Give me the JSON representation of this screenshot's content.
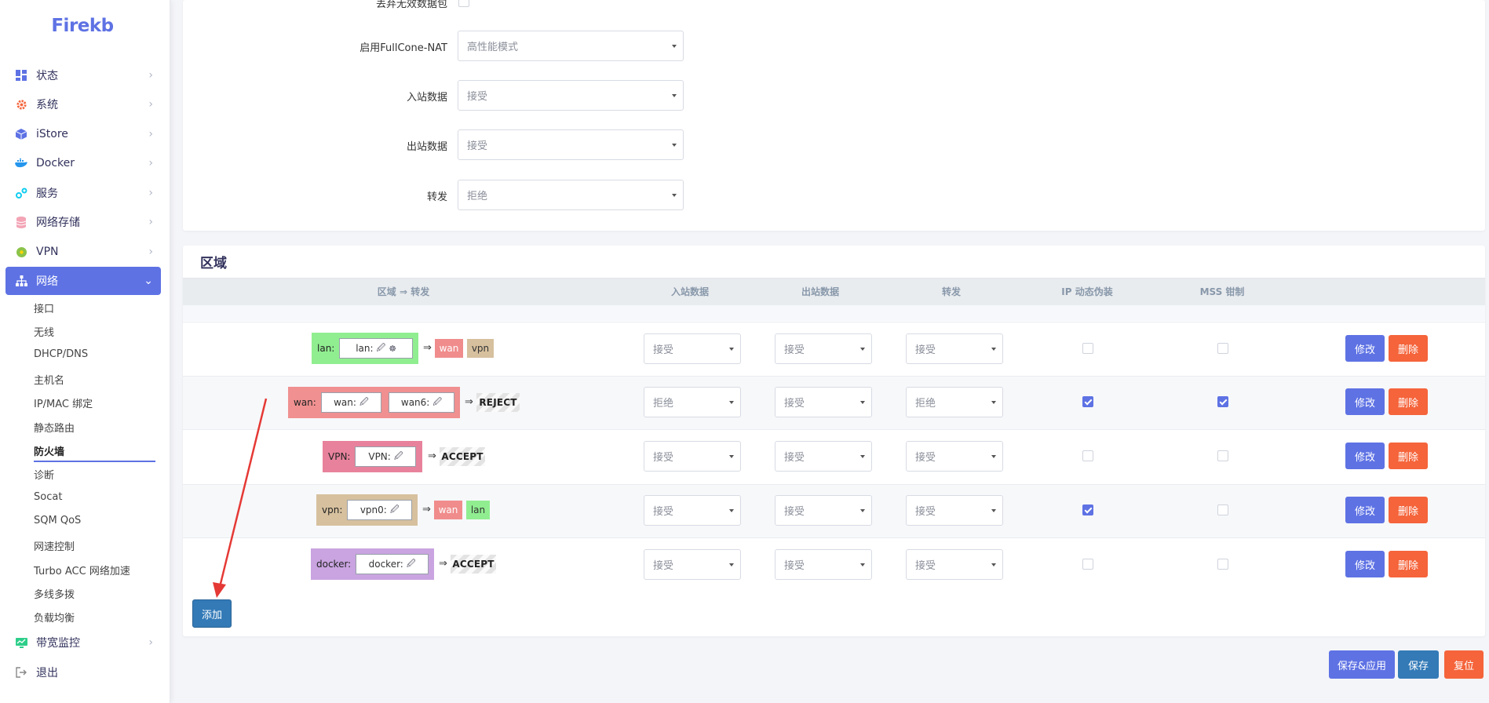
{
  "brand": "Firekb",
  "sidebar": {
    "items": [
      {
        "label": "状态",
        "icon": "dashboard-icon",
        "color": "#5e72e4"
      },
      {
        "label": "系统",
        "icon": "gear-icon",
        "color": "#f5643b"
      },
      {
        "label": "iStore",
        "icon": "cube-icon",
        "color": "#5e72e4"
      },
      {
        "label": "Docker",
        "icon": "docker-icon",
        "color": "#2496ed"
      },
      {
        "label": "服务",
        "icon": "services-icon",
        "color": "#11cdef"
      },
      {
        "label": "网络存储",
        "icon": "database-icon",
        "color": "#f3a4b5"
      },
      {
        "label": "VPN",
        "icon": "vpn-icon",
        "color": "#8bc34a"
      },
      {
        "label": "网络",
        "icon": "network-icon",
        "color": "#ffffff"
      }
    ],
    "network_sub": [
      "接口",
      "无线",
      "DHCP/DNS",
      "主机名",
      "IP/MAC 绑定",
      "静态路由",
      "防火墙",
      "诊断",
      "Socat",
      "SQM QoS",
      "网速控制",
      "Turbo ACC 网络加速",
      "多线多拨",
      "负载均衡"
    ],
    "bottom_items": [
      {
        "label": "带宽监控",
        "icon": "monitor-icon",
        "color": "#2dce89"
      },
      {
        "label": "退出",
        "icon": "logout-icon",
        "color": "#888888"
      }
    ]
  },
  "general": {
    "drop_invalid_label": "丢弃无效数据包",
    "fullcone_label": "启用FullCone-NAT",
    "fullcone_value": "高性能模式",
    "input_label": "入站数据",
    "input_value": "接受",
    "output_label": "出站数据",
    "output_value": "接受",
    "forward_label": "转发",
    "forward_value": "拒绝"
  },
  "zones": {
    "title": "区域",
    "headers": {
      "zone": "区域 ⇒ 转发",
      "input": "入站数据",
      "output": "出站数据",
      "forward": "转发",
      "masq": "IP 动态伪装",
      "mss": "MSS 钳制"
    },
    "arrow": "⇒",
    "rows": [
      {
        "name": "lan:",
        "color": "#90ee90",
        "ifaces": [
          "lan:"
        ],
        "targets": [
          "wan",
          "vpn"
        ],
        "input": "接受",
        "output": "接受",
        "forward": "接受",
        "masq": false,
        "mss": false
      },
      {
        "name": "wan:",
        "color": "#f09090",
        "ifaces": [
          "wan:",
          "wan6:"
        ],
        "targets": [
          "REJECT"
        ],
        "input": "拒绝",
        "output": "接受",
        "forward": "拒绝",
        "masq": true,
        "mss": true
      },
      {
        "name": "VPN:",
        "color": "#e8829c",
        "ifaces": [
          "VPN:"
        ],
        "targets": [
          "ACCEPT"
        ],
        "input": "接受",
        "output": "接受",
        "forward": "接受",
        "masq": false,
        "mss": false
      },
      {
        "name": "vpn:",
        "color": "#d6c09e",
        "ifaces": [
          "vpn0:"
        ],
        "targets": [
          "wan",
          "lan"
        ],
        "input": "接受",
        "output": "接受",
        "forward": "接受",
        "masq": true,
        "mss": false
      },
      {
        "name": "docker:",
        "color": "#c9a4e0",
        "ifaces": [
          "docker:"
        ],
        "targets": [
          "ACCEPT"
        ],
        "input": "接受",
        "output": "接受",
        "forward": "接受",
        "masq": false,
        "mss": false
      }
    ],
    "edit_label": "修改",
    "delete_label": "删除",
    "add_label": "添加"
  },
  "footer": {
    "apply_label": "保存&应用",
    "save_label": "保存",
    "reset_label": "复位"
  }
}
